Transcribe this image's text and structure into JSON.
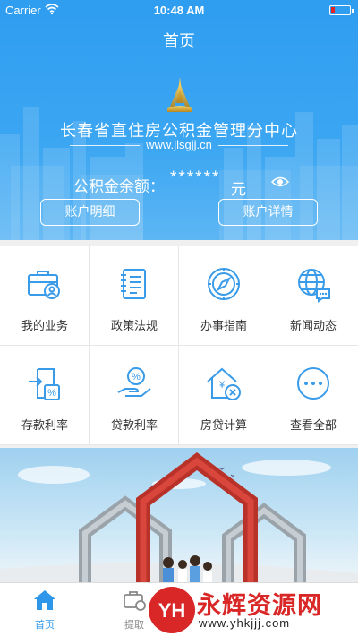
{
  "status_bar": {
    "carrier": "Carrier",
    "time": "10:48 AM",
    "battery_color": "#e62222"
  },
  "nav": {
    "title": "首页"
  },
  "header": {
    "org_name": "长春省直住房公积金管理分中心",
    "url": "www.jlsgjj.cn",
    "balance_label": "公积金余额：",
    "balance_value": "******",
    "balance_unit": "元",
    "eye_icon": "eye-icon",
    "account_detail_button": "账户明细",
    "account_info_button": "账户详情"
  },
  "grid": {
    "items": [
      {
        "label": "我的业务",
        "icon": "briefcase-user-icon"
      },
      {
        "label": "政策法规",
        "icon": "notebook-icon"
      },
      {
        "label": "办事指南",
        "icon": "compass-icon"
      },
      {
        "label": "新闻动态",
        "icon": "globe-chat-icon"
      },
      {
        "label": "存款利率",
        "icon": "deposit-rate-icon"
      },
      {
        "label": "贷款利率",
        "icon": "loan-rate-icon"
      },
      {
        "label": "房贷计算",
        "icon": "house-calc-icon"
      },
      {
        "label": "查看全部",
        "icon": "more-icon"
      }
    ]
  },
  "tabbar": {
    "tabs": [
      {
        "label": "首页",
        "icon": "home-icon",
        "active": true
      },
      {
        "label": "提取",
        "icon": "withdraw-icon",
        "active": false
      }
    ]
  },
  "watermark": {
    "brand": "永辉资源网",
    "url": "www.yhkjjj.com",
    "logo_text": "YH"
  },
  "colors": {
    "primary": "#2e97ea",
    "icon_blue": "#3a9be8",
    "watermark_red": "#d92626"
  }
}
